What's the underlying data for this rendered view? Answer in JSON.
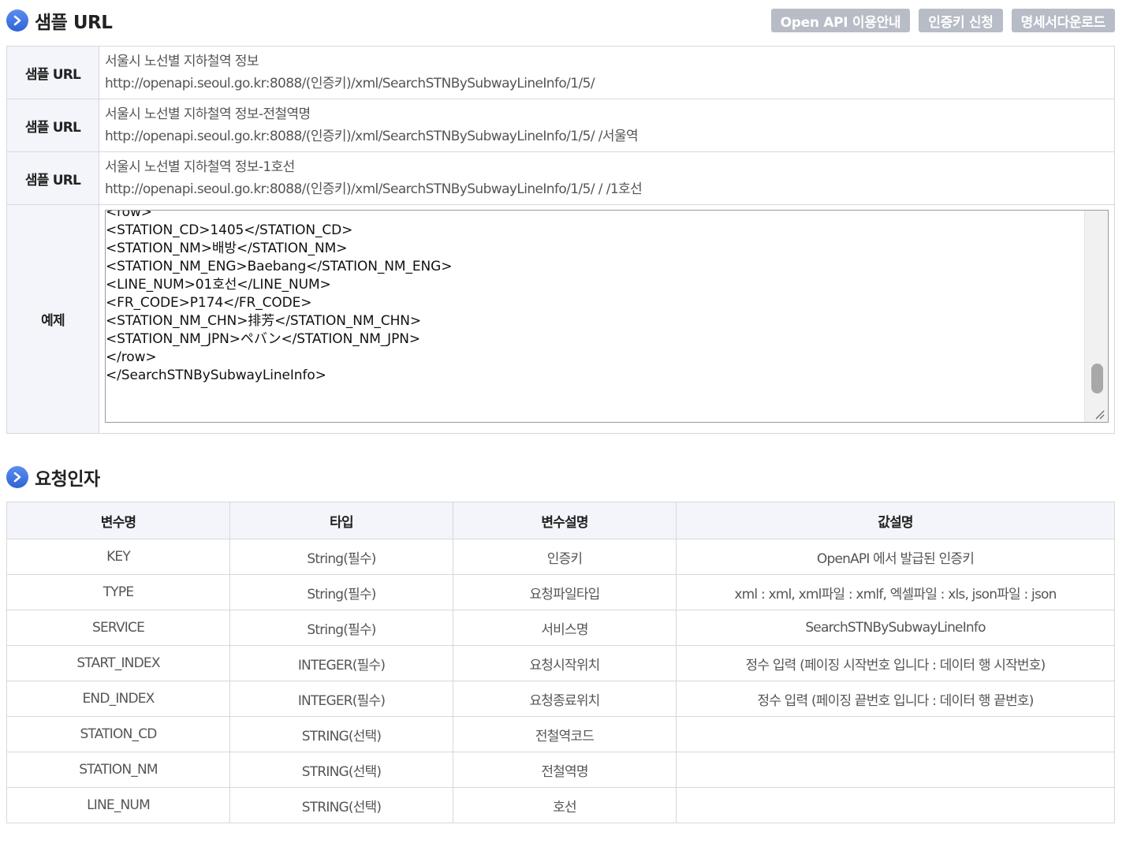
{
  "sample_section": {
    "title": "샘플 URL",
    "buttons": [
      "Open API 이용안내",
      "인증키 신청",
      "명세서다운로드"
    ],
    "rows": [
      {
        "label": "샘플 URL",
        "desc": "서울시 노선별 지하철역 정보",
        "url": "http://openapi.seoul.go.kr:8088/(인증키)/xml/SearchSTNBySubwayLineInfo/1/5/"
      },
      {
        "label": "샘플 URL",
        "desc": "서울시 노선별 지하철역 정보-전철역명",
        "url": "http://openapi.seoul.go.kr:8088/(인증키)/xml/SearchSTNBySubwayLineInfo/1/5/ /서울역"
      },
      {
        "label": "샘플 URL",
        "desc": "서울시 노선별 지하철역 정보-1호선",
        "url": "http://openapi.seoul.go.kr:8088/(인증키)/xml/SearchSTNBySubwayLineInfo/1/5/ / /1호선"
      }
    ],
    "example": {
      "label": "예제",
      "lines": [
        "<row>",
        "<STATION_CD>1405</STATION_CD>",
        "<STATION_NM>배방</STATION_NM>",
        "<STATION_NM_ENG>Baebang</STATION_NM_ENG>",
        "<LINE_NUM>01호선</LINE_NUM>",
        "<FR_CODE>P174</FR_CODE>",
        "<STATION_NM_CHN>排芳</STATION_NM_CHN>",
        "<STATION_NM_JPN>ペバン</STATION_NM_JPN>",
        "</row>",
        "</SearchSTNBySubwayLineInfo>"
      ]
    }
  },
  "params_section": {
    "title": "요청인자",
    "headers": [
      "변수명",
      "타입",
      "변수설명",
      "값설명"
    ],
    "rows": [
      [
        "KEY",
        "String(필수)",
        "인증키",
        "OpenAPI 에서 발급된 인증키"
      ],
      [
        "TYPE",
        "String(필수)",
        "요청파일타입",
        "xml : xml, xml파일 : xmlf, 엑셀파일 : xls, json파일 : json"
      ],
      [
        "SERVICE",
        "String(필수)",
        "서비스명",
        "SearchSTNBySubwayLineInfo"
      ],
      [
        "START_INDEX",
        "INTEGER(필수)",
        "요청시작위치",
        "정수 입력 (페이징 시작번호 입니다 : 데이터 행 시작번호)"
      ],
      [
        "END_INDEX",
        "INTEGER(필수)",
        "요청종료위치",
        "정수 입력 (페이징 끝번호 입니다 : 데이터 행 끝번호)"
      ],
      [
        "STATION_CD",
        "STRING(선택)",
        "전철역코드",
        ""
      ],
      [
        "STATION_NM",
        "STRING(선택)",
        "전철역명",
        ""
      ],
      [
        "LINE_NUM",
        "STRING(선택)",
        "호선",
        ""
      ]
    ]
  },
  "colors": {
    "accent": "#3a6fe0",
    "button_bg": "#b8bcc6",
    "header_bg": "#f3f5fa",
    "border": "#d5d8de"
  },
  "icons": [
    "chevron-right-icon"
  ]
}
